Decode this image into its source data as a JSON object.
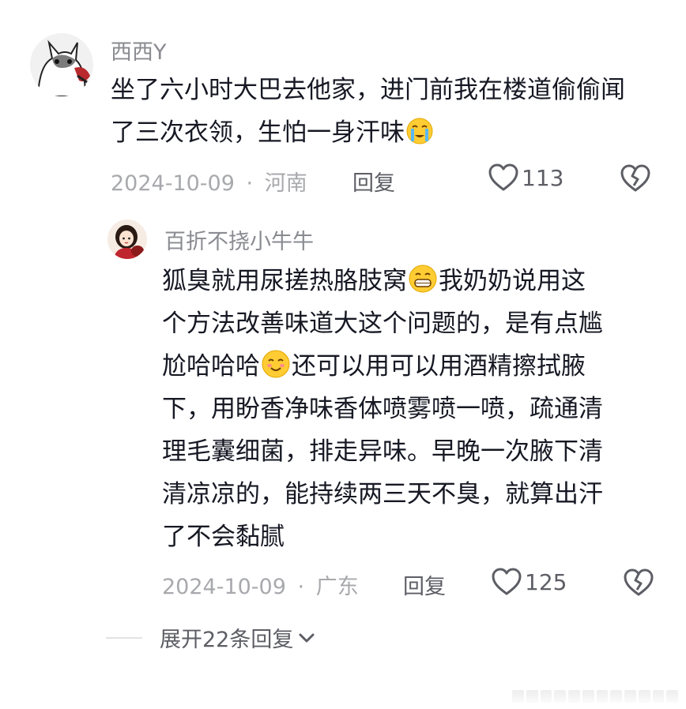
{
  "comments": [
    {
      "username": "西西Y",
      "avatar_icon": "cat-avatar-icon",
      "content_lines": [
        "坐了六小时大巴去他家，进门前我在楼道偷偷闻",
        "了三次衣领，生怕一身汗味"
      ],
      "emoji_icon": "crying-face-emoji-icon",
      "date": "2024-10-09",
      "location": "河南",
      "reply_label": "回复",
      "likes": "113"
    },
    {
      "username": "百折不挠小牛牛",
      "avatar_icon": "girl-avatar-icon",
      "content_lines": [
        "狐臭就用尿搓热胳肢窝",
        "我奶奶说用这",
        "个方法改善味道大这个问题的，是有点尴",
        "尬哈哈哈",
        "还可以用可以用酒精擦拭腋",
        "下，用盼香净味香体喷雾喷一喷，疏通清",
        "理毛囊细菌，排走异味。早晚一次腋下清",
        "清凉凉的，能持续两三天不臭，就算出汗",
        "了不会黏腻"
      ],
      "date": "2024-10-09",
      "location": "广东",
      "reply_label": "回复",
      "likes": "125"
    }
  ],
  "separator": "·",
  "expand_replies_label": "展开22条回复",
  "colors": {
    "text": "#161823",
    "secondary": "#8a8b91",
    "meta": "#a8a9ad",
    "action": "#5d5e65"
  }
}
